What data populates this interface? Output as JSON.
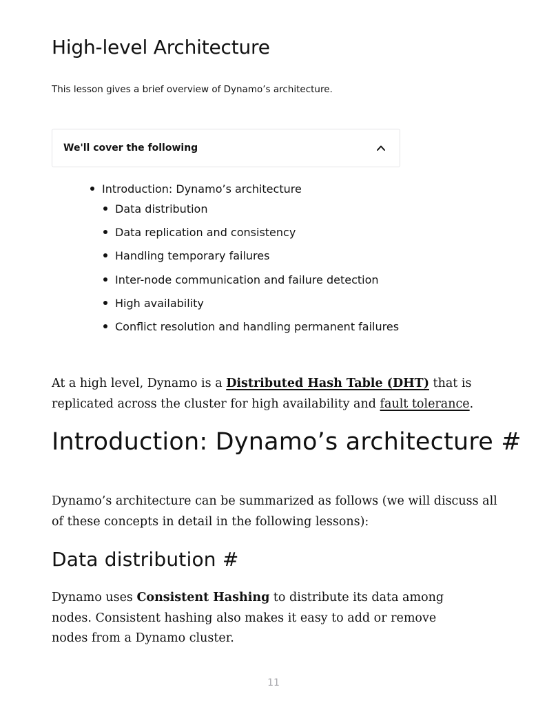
{
  "header": {
    "title": "High-level Architecture",
    "subtitle": "This lesson gives a brief overview of Dynamo’s architecture."
  },
  "toc": {
    "label": "We'll cover the following",
    "expanded": true,
    "toggle_icon": "chevron-up-icon",
    "items": [
      {
        "label": "Introduction: Dynamo’s architecture",
        "level": 1
      },
      {
        "label": "Data distribution",
        "level": 2
      },
      {
        "label": "Data replication and consistency",
        "level": 2
      },
      {
        "label": "Handling temporary failures",
        "level": 2
      },
      {
        "label": "Inter-node communication and failure detection",
        "level": 2
      },
      {
        "label": "High availability",
        "level": 2
      },
      {
        "label": "Conflict resolution and handling permanent failures",
        "level": 2
      }
    ]
  },
  "intro_paragraph": {
    "prefix": "At a high level, Dynamo is a ",
    "dht_link": "Distributed Hash Table (DHT)",
    "middle": " that is replicated across the cluster for high availability and ",
    "fault_link": "fault tolerance",
    "suffix": "."
  },
  "section_intro": {
    "heading": "Introduction: Dynamo’s architecture",
    "anchor": "#",
    "paragraph": "Dynamo’s architecture can be summarized as follows (we will discuss all of these concepts in detail in the following lessons):"
  },
  "section_data_distribution": {
    "heading": "Data distribution",
    "anchor": "#",
    "prefix": "Dynamo uses ",
    "bold": "Consistent Hashing",
    "suffix": " to distribute its data among nodes. Consistent hashing also makes it easy to add or remove nodes from a Dynamo cluster."
  },
  "footer": {
    "page_number": "11"
  }
}
